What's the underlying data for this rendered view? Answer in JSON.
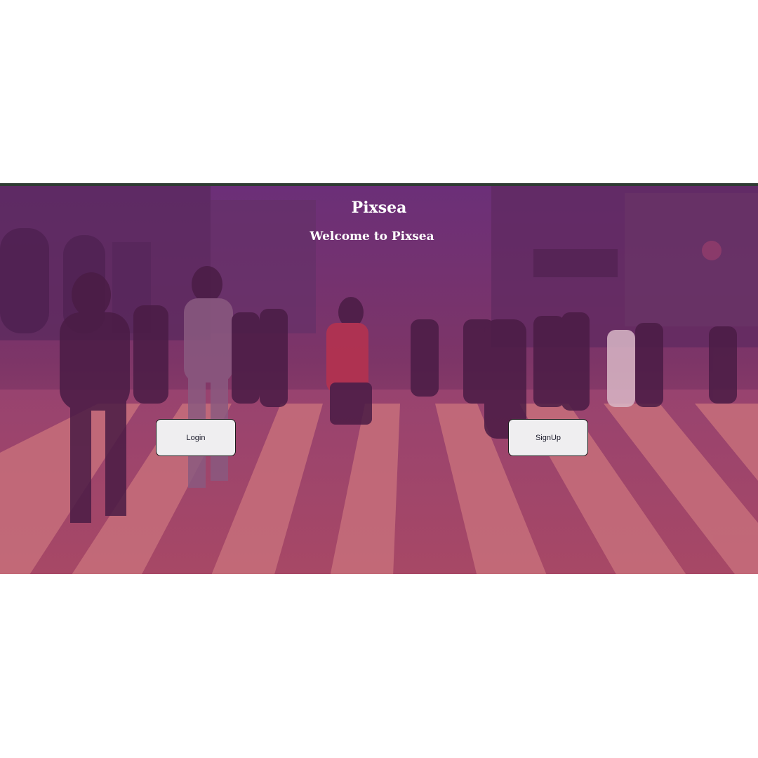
{
  "hero": {
    "title": "Pixsea",
    "subtitle": "Welcome to Pixsea"
  },
  "buttons": {
    "login_label": "Login",
    "signup_label": "SignUp"
  },
  "colors": {
    "overlay_top": "#6b2f78",
    "overlay_bottom": "#b04d68",
    "button_bg": "#efeef0",
    "title_text": "#ffffff"
  }
}
